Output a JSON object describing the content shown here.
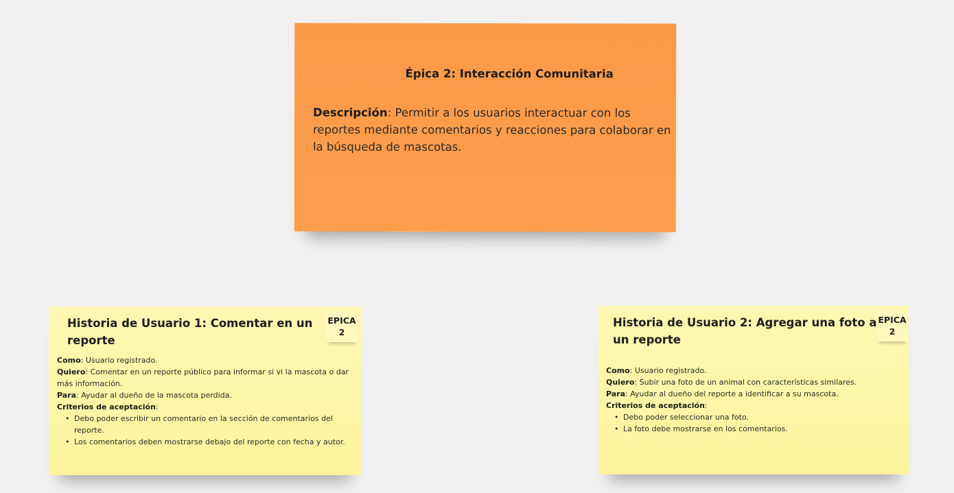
{
  "epic": {
    "title": "Épica 2: Interacción Comunitaria",
    "description_label": "Descripción",
    "description_text": ": Permitir a los usuarios interactuar con los reportes mediante comentarios y reacciones para colaborar en la búsqueda de mascotas.",
    "color": "#fc9c4a"
  },
  "stories": [
    {
      "title": "Historia de Usuario 1: Comentar en un reporte",
      "tag_line1": "EPICA",
      "tag_line2": "2",
      "como_label": "Como",
      "como_text": ": Usuario registrado.",
      "quiero_label": "Quiero",
      "quiero_text": ": Comentar en un reporte público para informar si vi la mascota o dar más información.",
      "para_label": "Para",
      "para_text": ": Ayudar al dueño de la mascota perdida.",
      "criterios_label": "Criterios de aceptación",
      "criterios_suffix": ":",
      "criterios": [
        "Debo poder escribir un comentario en la sección de comentarios del reporte.",
        "Los comentarios deben mostrarse debajo del reporte con fecha y autor."
      ],
      "color": "#fdf5a8"
    },
    {
      "title": "Historia de Usuario 2: Agregar una foto a un reporte",
      "tag_line1": "EPICA",
      "tag_line2": "2",
      "como_label": "Como",
      "como_text": ": Usuario registrado.",
      "quiero_label": "Quiero",
      "quiero_text": ": Subir una foto de un animal con características similares.",
      "para_label": "Para",
      "para_text": ": Ayudar al dueño del reporte a identificar a su mascota.",
      "criterios_label": "Criterios de aceptación",
      "criterios_suffix": ":",
      "criterios": [
        "Debo poder seleccionar una foto.",
        "La foto debe mostrarse en los comentarios."
      ],
      "color": "#fdf5a8"
    }
  ]
}
